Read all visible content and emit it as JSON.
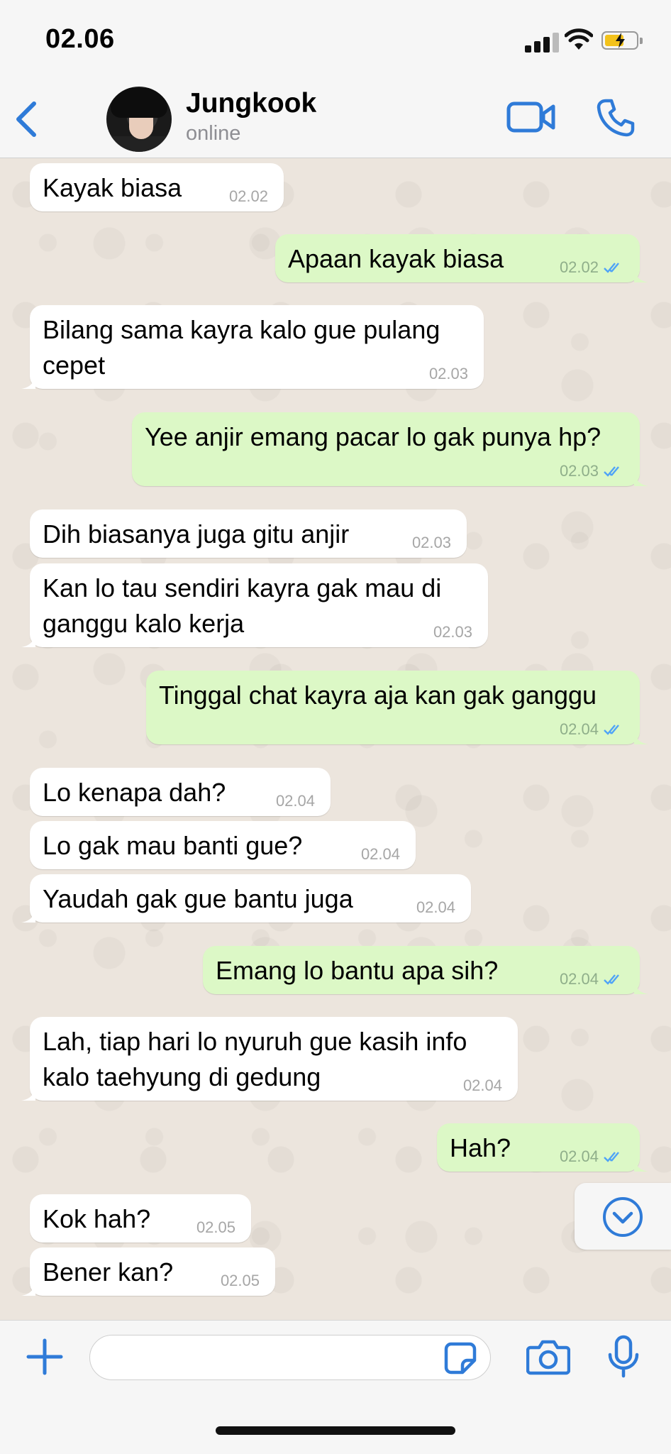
{
  "status_bar": {
    "time": "02.06"
  },
  "header": {
    "contact_name": "Jungkook",
    "contact_status": "online"
  },
  "colors": {
    "accent": "#2f7bd8",
    "incoming_bubble": "#ffffff",
    "outgoing_bubble": "#dcf8c6",
    "chat_bg": "#ece5dd",
    "read_tick": "#4fa3f7"
  },
  "messages": [
    {
      "dir": "in",
      "lines": [
        "Kayak biasa"
      ],
      "time": "02.02"
    },
    {
      "dir": "out",
      "lines": [
        "Apaan kayak biasa"
      ],
      "time": "02.02",
      "status": "read"
    },
    {
      "dir": "in",
      "lines": [
        "Bilang sama kayra kalo gue pulang",
        "cepet"
      ],
      "time": "02.03"
    },
    {
      "dir": "out",
      "lines": [
        "Yee anjir emang pacar lo gak punya hp?"
      ],
      "time": "02.03",
      "status": "read"
    },
    {
      "dir": "in",
      "lines": [
        "Dih biasanya juga gitu anjir"
      ],
      "time": "02.03"
    },
    {
      "dir": "in",
      "lines": [
        "Kan lo tau sendiri kayra gak mau di",
        "ganggu kalo kerja"
      ],
      "time": "02.03"
    },
    {
      "dir": "out",
      "lines": [
        "Tinggal chat kayra aja kan gak ganggu"
      ],
      "time": "02.04",
      "status": "read"
    },
    {
      "dir": "in",
      "lines": [
        "Lo kenapa dah?"
      ],
      "time": "02.04"
    },
    {
      "dir": "in",
      "lines": [
        "Lo gak mau banti gue?"
      ],
      "time": "02.04"
    },
    {
      "dir": "in",
      "lines": [
        "Yaudah gak gue bantu juga"
      ],
      "time": "02.04"
    },
    {
      "dir": "out",
      "lines": [
        "Emang lo bantu apa sih?"
      ],
      "time": "02.04",
      "status": "read"
    },
    {
      "dir": "in",
      "lines": [
        "Lah, tiap hari lo nyuruh gue kasih info",
        "kalo taehyung di gedung"
      ],
      "time": "02.04"
    },
    {
      "dir": "out",
      "lines": [
        "Hah?"
      ],
      "time": "02.04",
      "status": "read"
    },
    {
      "dir": "in",
      "lines": [
        "Kok hah?"
      ],
      "time": "02.05"
    },
    {
      "dir": "in",
      "lines": [
        "Bener kan?"
      ],
      "time": "02.05"
    }
  ],
  "composer": {
    "value": "",
    "placeholder": ""
  },
  "icons": {
    "back": "chevron-left-icon",
    "video": "video-camera-icon",
    "call": "phone-icon",
    "add": "plus-icon",
    "sticker": "sticker-icon",
    "camera": "camera-icon",
    "mic": "microphone-icon",
    "scroll": "chevron-down-circle-icon"
  }
}
